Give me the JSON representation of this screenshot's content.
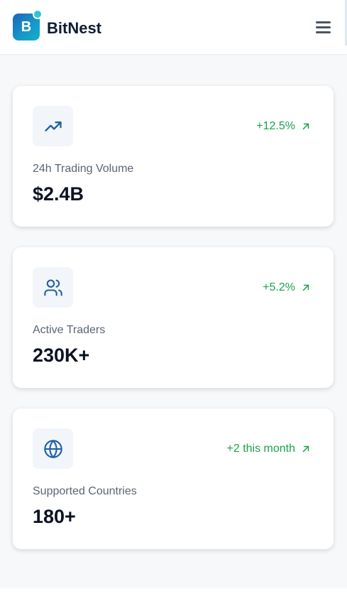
{
  "header": {
    "logo_letter": "B",
    "brand": "BitNest",
    "menu_icon": "hamburger-icon"
  },
  "colors": {
    "accent": "#1f63b8",
    "logo_teal": "#2bc6d6",
    "positive": "#17a34a",
    "icon": "#1f5fa6",
    "page_bg": "#f6f8fa"
  },
  "stats": [
    {
      "icon": "trending-up-icon",
      "change": "+12.5%",
      "change_icon": "arrow-up-right-icon",
      "label": "24h Trading Volume",
      "value": "$2.4B"
    },
    {
      "icon": "users-icon",
      "change": "+5.2%",
      "change_icon": "arrow-up-right-icon",
      "label": "Active Traders",
      "value": "230K+"
    },
    {
      "icon": "globe-icon",
      "change": "+2 this month",
      "change_icon": "arrow-up-right-icon",
      "label": "Supported Countries",
      "value": "180+"
    }
  ]
}
